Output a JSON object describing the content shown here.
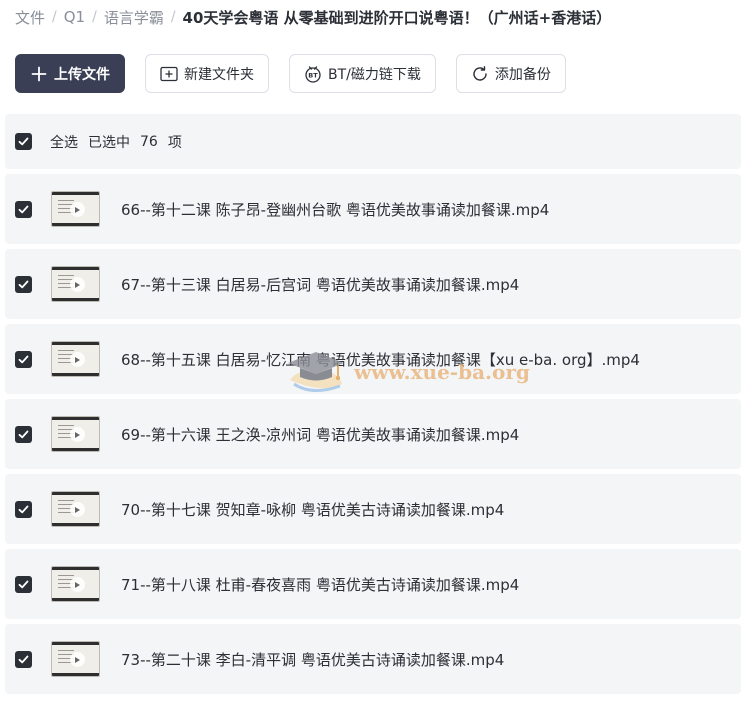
{
  "breadcrumb": {
    "items": [
      "文件",
      "Q1",
      "语言学霸"
    ],
    "separator": "/",
    "current": "40天学会粤语 从零基础到进阶开口说粤语！（广州话+香港话）"
  },
  "toolbar": {
    "upload_label": "上传文件",
    "new_folder_label": "新建文件夹",
    "bt_label": "BT/磁力链下载",
    "backup_label": "添加备份"
  },
  "selection": {
    "select_all_label": "全选",
    "selected_label": "已选中",
    "count": "76",
    "unit": "项"
  },
  "files": [
    {
      "name": "66--第十二课 陈子昂-登幽州台歌 粤语优美故事诵读加餐课.mp4",
      "checked": true
    },
    {
      "name": "67--第十三课 白居易-后宫词 粤语优美故事诵读加餐课.mp4",
      "checked": true
    },
    {
      "name": "68--第十五课 白居易-忆江南 粤语优美故事诵读加餐课【xu e-ba. org】.mp4",
      "checked": true
    },
    {
      "name": "69--第十六课 王之涣-凉州词 粤语优美故事诵读加餐课.mp4",
      "checked": true
    },
    {
      "name": "70--第十七课 贺知章-咏柳 粤语优美古诗诵读加餐课.mp4",
      "checked": true
    },
    {
      "name": "71--第十八课 杜甫-春夜喜雨 粤语优美古诗诵读加餐课.mp4",
      "checked": true
    },
    {
      "name": "73--第二十课 李白-清平调 粤语优美古诗诵读加餐课.mp4",
      "checked": true
    }
  ],
  "watermark": {
    "text": "www.xue-ba.org"
  },
  "icons": {
    "upload": "plus-icon",
    "new_folder": "folder-plus-icon",
    "bt": "bt-icon",
    "backup": "refresh-icon",
    "checkbox": "check-icon",
    "thumbnail": "video-thumbnail"
  },
  "colors": {
    "primary_button": "#3a3f55",
    "row_background": "#f4f5f7",
    "checkbox": "#2b2f36",
    "breadcrumb_muted": "#8a8f99",
    "text": "#2b2f36"
  }
}
